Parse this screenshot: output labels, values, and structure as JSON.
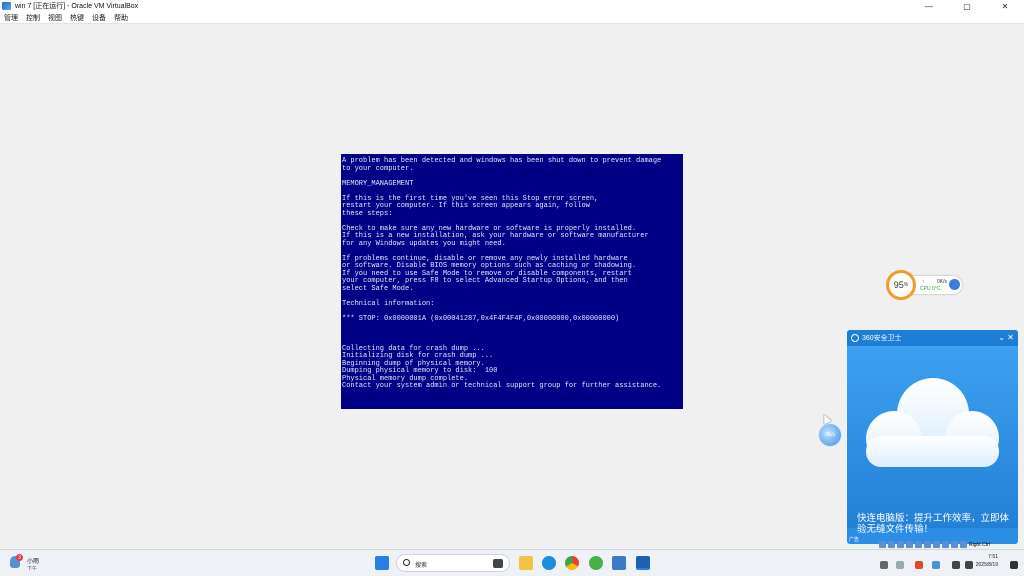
{
  "window": {
    "title": "win 7 [正在运行] - Oracle VM VirtualBox",
    "controls": [
      "—",
      "▢",
      "✕"
    ]
  },
  "menu": [
    "管理",
    "控制",
    "视图",
    "热键",
    "设备",
    "帮助"
  ],
  "bsod": {
    "lines": [
      "A problem has been detected and windows has been shut down to prevent damage",
      "to your computer.",
      "",
      "MEMORY_MANAGEMENT",
      "",
      "If this is the first time you've seen this Stop error screen,",
      "restart your computer. If this screen appears again, follow",
      "these steps:",
      "",
      "Check to make sure any new hardware or software is properly installed.",
      "If this is a new installation, ask your hardware or software manufacturer",
      "for any Windows updates you might need.",
      "",
      "If problems continue, disable or remove any newly installed hardware",
      "or software. Disable BIOS memory options such as caching or shadowing.",
      "If you need to use Safe Mode to remove or disable components, restart",
      "your computer, press F8 to select Advanced Startup Options, and then",
      "select Safe Mode.",
      "",
      "Technical information:",
      "",
      "*** STOP: 0x0000001A (0x00041287,0x4F4F4F4F,0x00000000,0x00000000)",
      "",
      "",
      "",
      "Collecting data for crash dump ...",
      "Initializing disk for crash dump ...",
      "Beginning dump of physical memory.",
      "Dumping physical memory to disk:  100",
      "Physical memory dump complete.",
      "Contact your system admin or technical support group for further assistance."
    ]
  },
  "perf": {
    "percent": "95",
    "unit": "%",
    "up": "↑",
    "speed": "0K/s",
    "cpu": "CPU 0°C"
  },
  "float_ball": {
    "label": "0B/s"
  },
  "popup": {
    "title": "360安全卫士",
    "controls": [
      "⌄",
      "✕"
    ],
    "message": "快连电脑版：提升工作效率，立即体验无缝文件传输！",
    "ad": "广告"
  },
  "taskbar": {
    "weather_badge": "3",
    "weather_title": "小雨",
    "weather_sub": "下午",
    "search_placeholder": "搜索",
    "time": "7:51",
    "date": "2025/8/19",
    "vm_status_text": "Right Ctrl"
  },
  "colors": {
    "bsod_bg": "#000086",
    "popup_bg": "#2b8de3",
    "desktop_bg": "#f0f0f0"
  }
}
